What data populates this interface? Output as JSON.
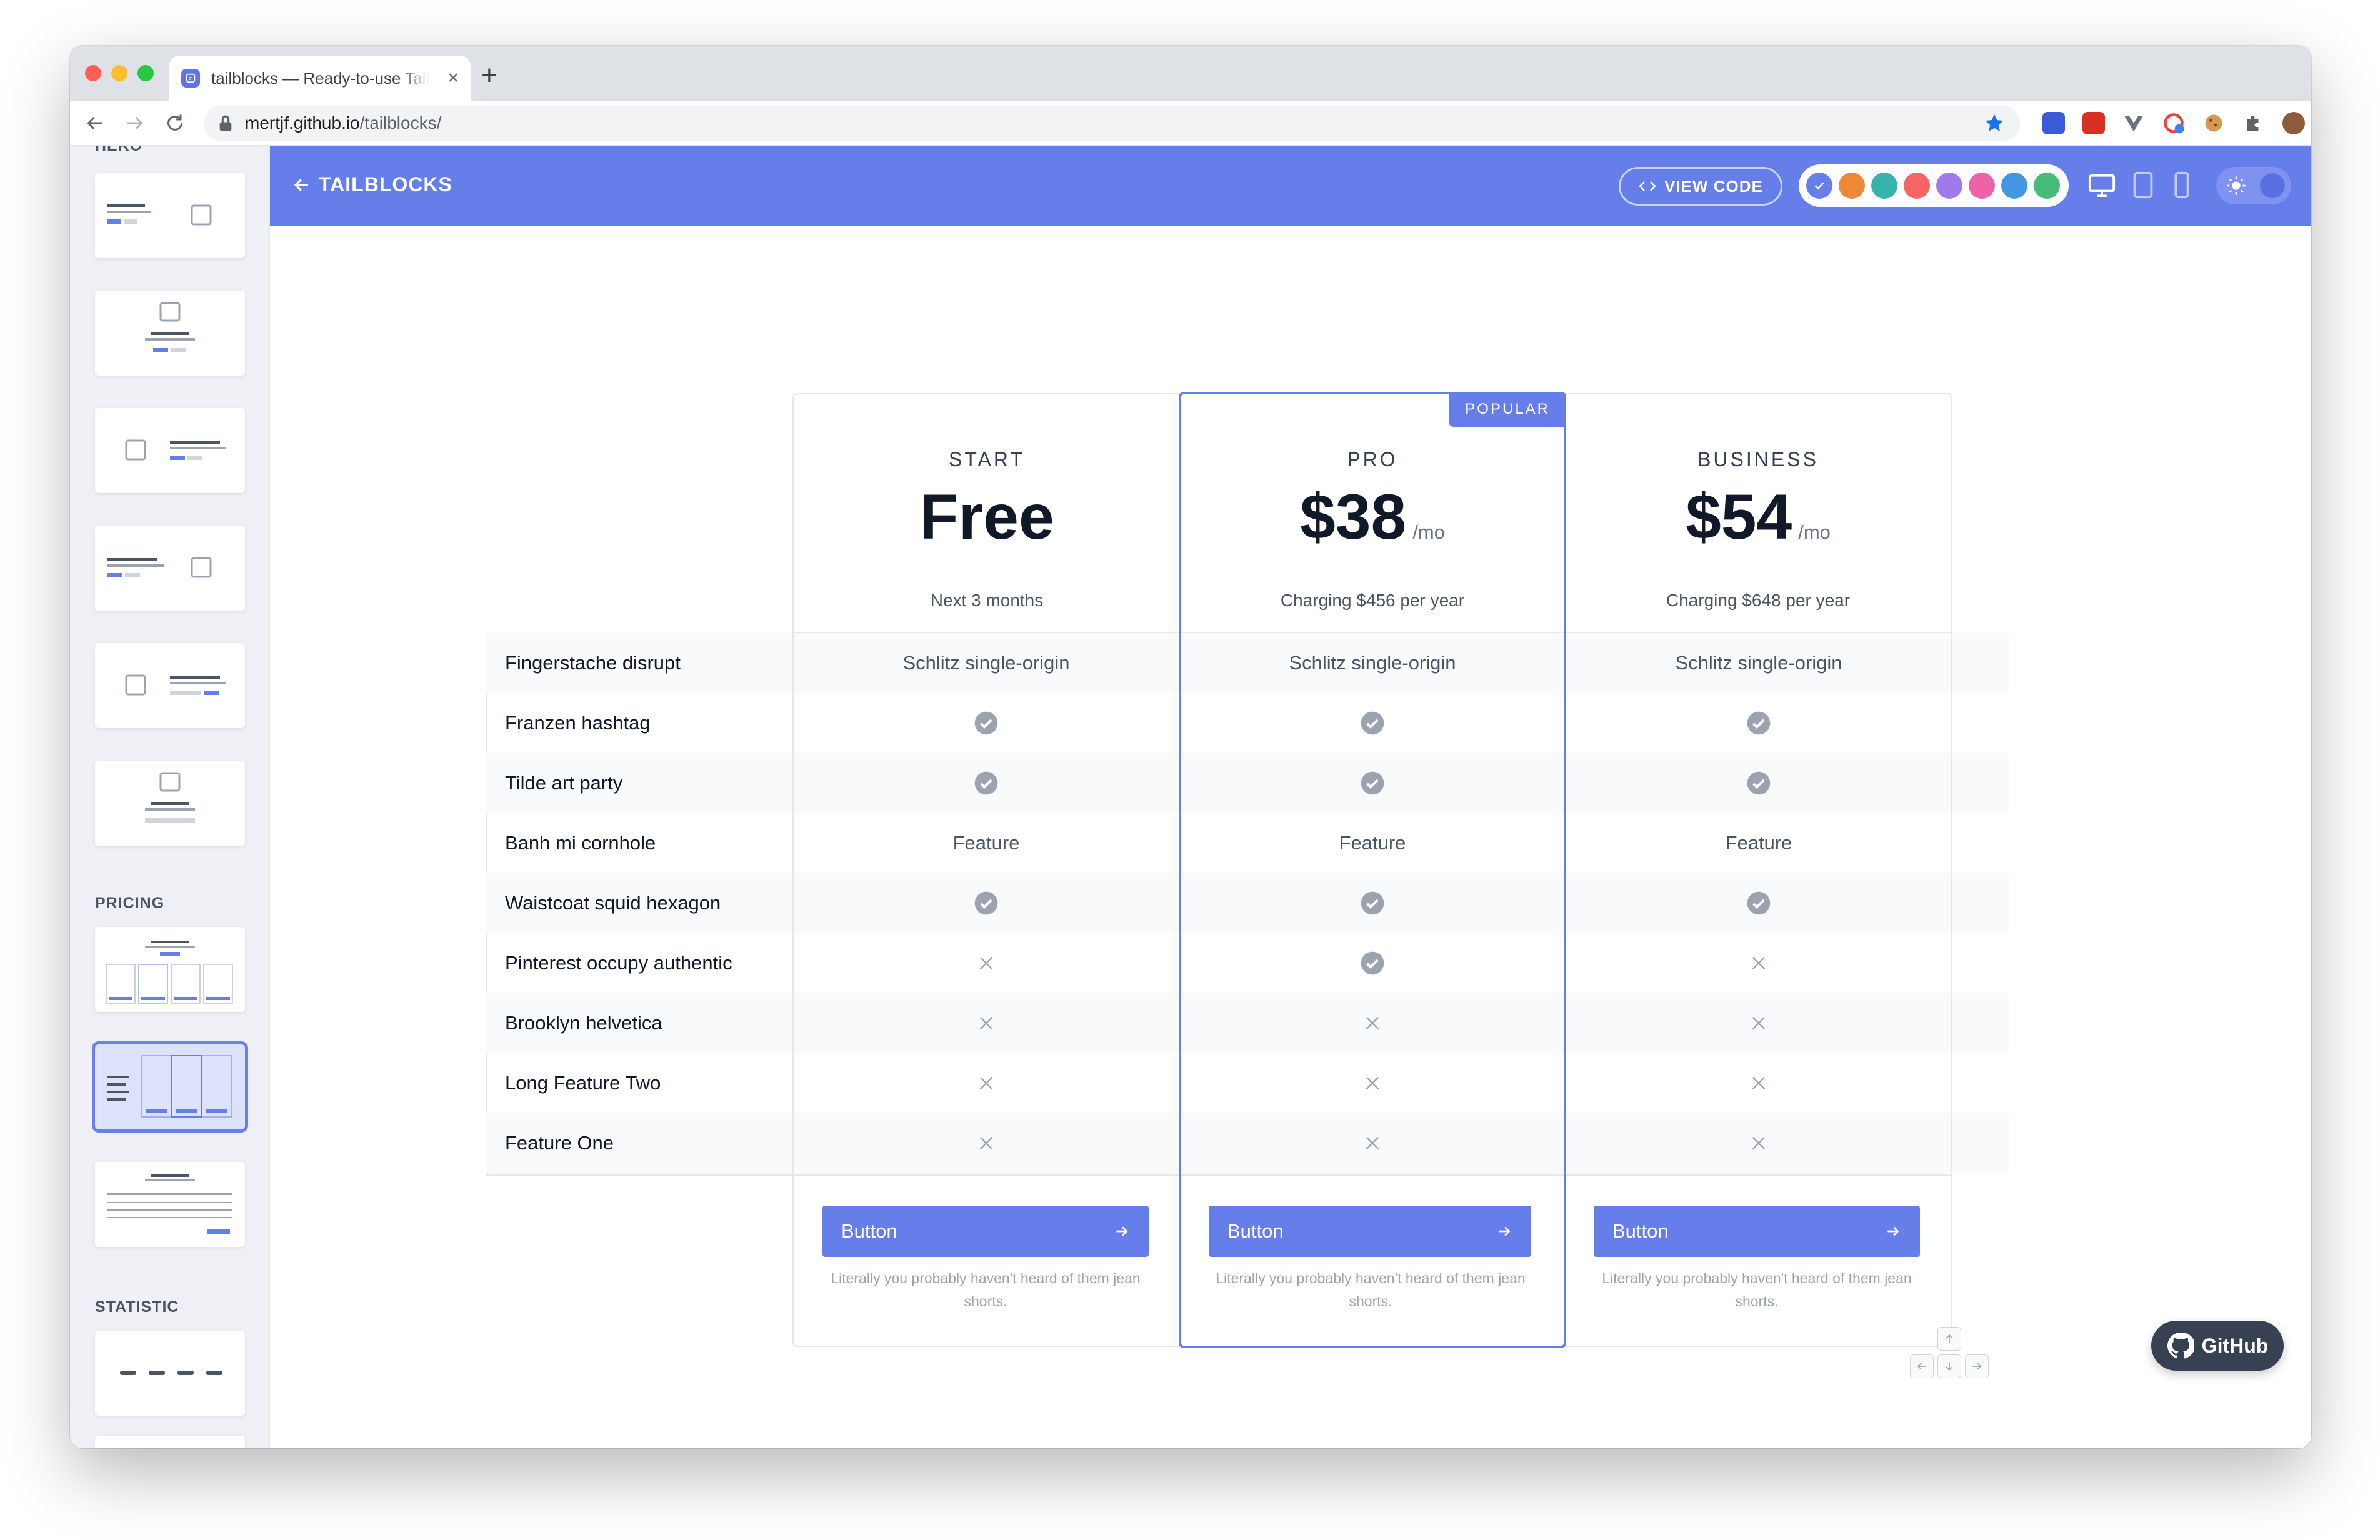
{
  "browser": {
    "tab_title": "tailblocks — Ready-to-use Tailwind CSS blocks",
    "tab_close": "×",
    "new_tab": "+",
    "url_host": "mertjf.github.io",
    "url_path": "/tailblocks/"
  },
  "sidebar": {
    "partial_label": "HERO",
    "sections": {
      "pricing": "PRICING",
      "statistic": "STATISTIC"
    }
  },
  "header": {
    "back_label": "TAILBLOCKS",
    "view_code_label": "VIEW CODE",
    "colors": [
      "#667eea",
      "#ed8936",
      "#38b2ac",
      "#f56565",
      "#9f7aea",
      "#ed64a6",
      "#4299e1",
      "#48bb78"
    ],
    "selected_color": "indigo"
  },
  "pricing": {
    "plans": [
      {
        "name": "START",
        "price": "Free",
        "unit": "",
        "note": "Next 3 months",
        "button": "Button",
        "footer": "Literally you probably haven't heard of them jean shorts."
      },
      {
        "name": "PRO",
        "price": "$38",
        "unit": "/mo",
        "note": "Charging $456 per year",
        "button": "Button",
        "footer": "Literally you probably haven't heard of them jean shorts.",
        "badge": "POPULAR"
      },
      {
        "name": "BUSINESS",
        "price": "$54",
        "unit": "/mo",
        "note": "Charging $648 per year",
        "button": "Button",
        "footer": "Literally you probably haven't heard of them jean shorts."
      }
    ],
    "features": [
      {
        "label": "Fingerstache disrupt",
        "values": [
          "Schlitz single-origin",
          "Schlitz single-origin",
          "Schlitz single-origin"
        ]
      },
      {
        "label": "Franzen hashtag",
        "values": [
          "check",
          "check",
          "check"
        ]
      },
      {
        "label": "Tilde art party",
        "values": [
          "check",
          "check",
          "check"
        ]
      },
      {
        "label": "Banh mi cornhole",
        "values": [
          "Feature",
          "Feature",
          "Feature"
        ]
      },
      {
        "label": "Waistcoat squid hexagon",
        "values": [
          "check",
          "check",
          "check"
        ]
      },
      {
        "label": "Pinterest occupy authentic",
        "values": [
          "cross",
          "check",
          "cross"
        ]
      },
      {
        "label": "Brooklyn helvetica",
        "values": [
          "cross",
          "cross",
          "cross"
        ]
      },
      {
        "label": "Long Feature Two",
        "values": [
          "cross",
          "cross",
          "cross"
        ]
      },
      {
        "label": "Feature One",
        "values": [
          "cross",
          "cross",
          "cross"
        ]
      }
    ]
  },
  "github_label": "GitHub"
}
